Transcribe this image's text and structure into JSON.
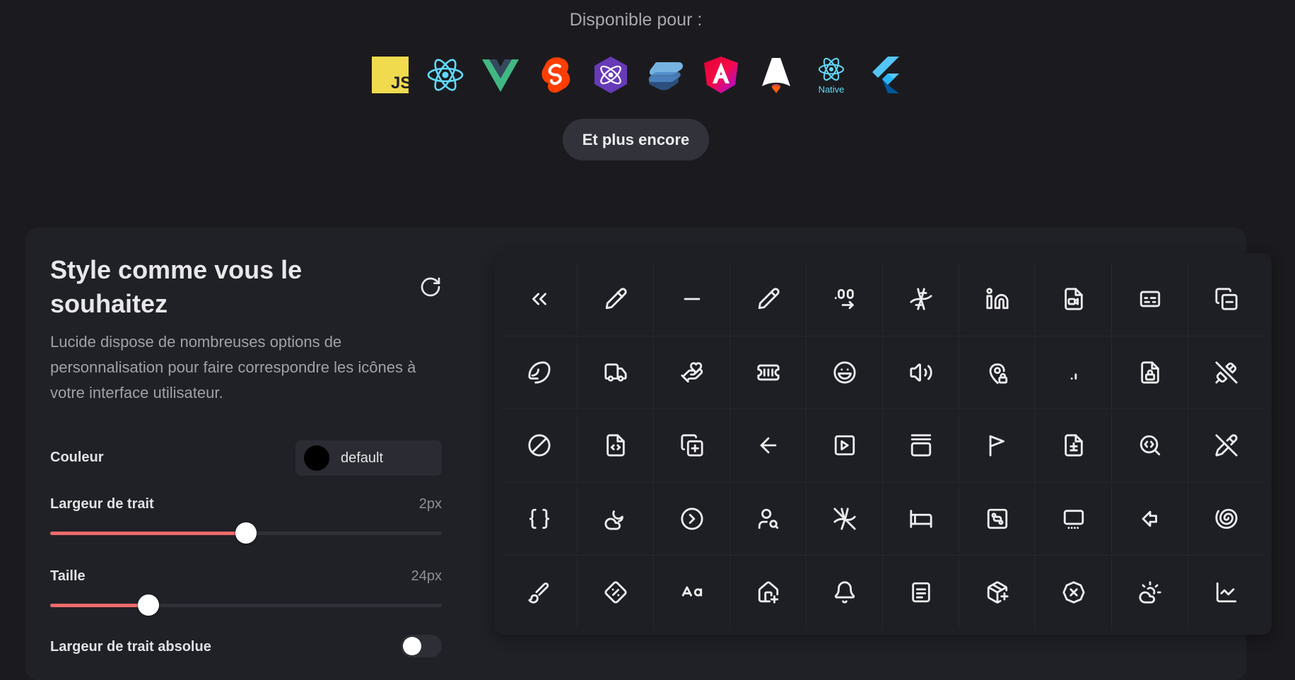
{
  "header": {
    "available_label": "Disponible pour :",
    "frameworks": [
      "js-icon",
      "react-icon",
      "vue-icon",
      "svelte-icon",
      "preact-icon",
      "solid-icon",
      "angular-icon",
      "astro-icon",
      "react-native-icon",
      "flutter-icon"
    ],
    "native_label": "Native",
    "js_label": "JS",
    "more_button": "Et plus encore"
  },
  "customizer": {
    "title": "Style comme vous le souhaitez",
    "description": "Lucide dispose de nombreuses options de personnalisation pour faire correspondre les icônes à votre interface utilisateur.",
    "color": {
      "label": "Couleur",
      "value": "default",
      "swatch": "#000000"
    },
    "stroke_width": {
      "label": "Largeur de trait",
      "value": "2px",
      "fraction": 0.5
    },
    "size": {
      "label": "Taille",
      "value": "24px",
      "fraction": 0.25
    },
    "absolute_stroke": {
      "label": "Largeur de trait absolue",
      "enabled": false
    },
    "accent_color": "#f06a6a"
  },
  "icon_grid": [
    [
      "chevrons-left-icon",
      "pen-icon",
      "minus-icon",
      "pencil-icon",
      "decimals-arrow-right-icon",
      "dna-icon",
      "linkedin-icon",
      "file-video-icon",
      "captions-icon",
      "copy-minus-icon"
    ],
    [
      "bean-icon",
      "truck-icon",
      "hand-heart-icon",
      "ticket-icon",
      "laugh-icon",
      "volume-icon",
      "map-pin-lock-icon",
      "decimal-icon",
      "file-lock-icon",
      "unlink-icon"
    ],
    [
      "ban-icon",
      "file-code-icon",
      "copy-plus-icon",
      "arrow-left-icon",
      "square-play-icon",
      "gallery-vertical-icon",
      "flag-icon",
      "file-diff-icon",
      "search-code-icon",
      "pencil-off-icon"
    ],
    [
      "braces-icon",
      "cloud-moon-icon",
      "circle-chevron-right-icon",
      "user-search-icon",
      "dna-off-icon",
      "bed-icon",
      "scan-face-icon",
      "screen-share-icon",
      "arrow-big-left-icon",
      "shell-icon"
    ],
    [
      "brush-icon",
      "diamond-percent-icon",
      "case-sensitive-icon",
      "house-plus-icon",
      "bell-icon",
      "file-text-icon",
      "package-plus-icon",
      "circle-x-icon",
      "cloud-sun-icon",
      "chart-line-icon"
    ]
  ]
}
